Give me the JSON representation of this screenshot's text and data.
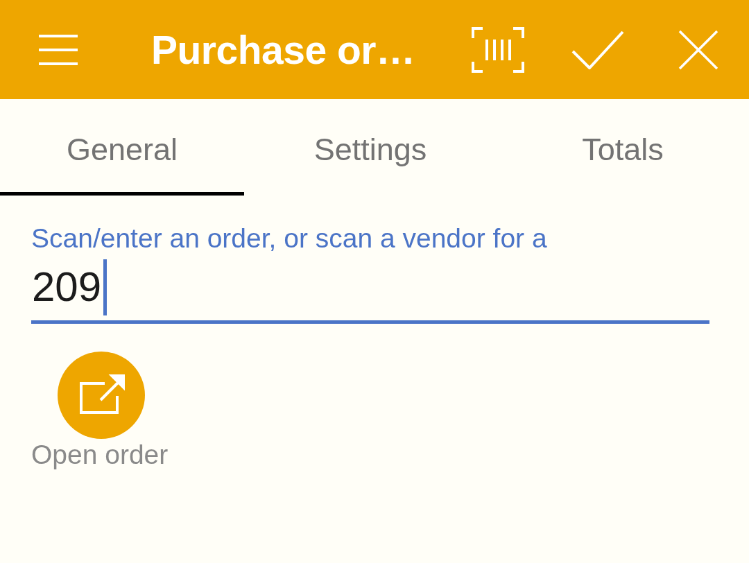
{
  "app_bar": {
    "title": "Purchase or…"
  },
  "tabs": [
    {
      "label": "General",
      "selected": true
    },
    {
      "label": "Settings",
      "selected": false
    },
    {
      "label": "Totals",
      "selected": false
    }
  ],
  "order_field": {
    "label": "Scan/enter an order, or scan a vendor for a",
    "value": "209",
    "focused": true
  },
  "actions": [
    {
      "label": "Open order"
    }
  ]
}
